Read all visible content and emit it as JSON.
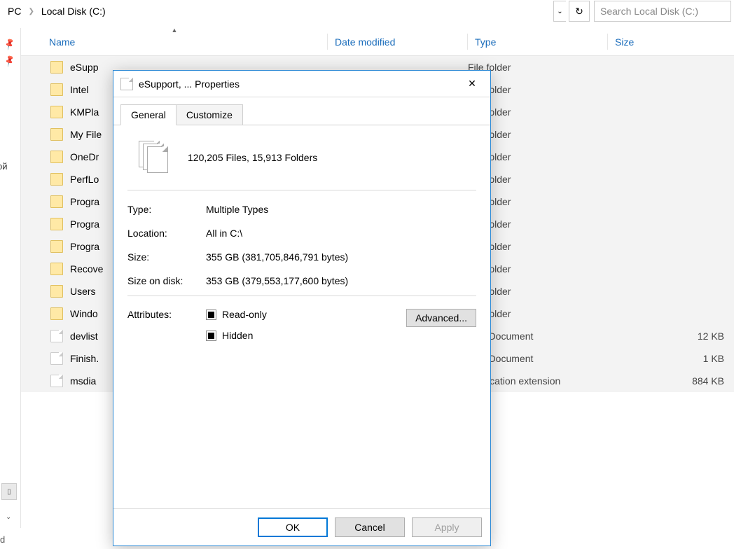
{
  "breadcrumb": {
    "seg1": "PC",
    "seg2": "Local Disk (C:)"
  },
  "search": {
    "placeholder": "Search Local Disk (C:)"
  },
  "sidebar": {
    "cutoff": "ой",
    "bottom": "d"
  },
  "columns": {
    "name": "Name",
    "date": "Date modified",
    "type": "Type",
    "size": "Size"
  },
  "rows": [
    {
      "name": "eSupp",
      "type": "File folder",
      "size": "",
      "icon": "folder"
    },
    {
      "name": "Intel",
      "type": "File folder",
      "size": "",
      "icon": "folder"
    },
    {
      "name": "KMPla",
      "type": "File folder",
      "size": "",
      "icon": "folder"
    },
    {
      "name": "My File",
      "type": "File folder",
      "size": "",
      "icon": "folder"
    },
    {
      "name": "OneDr",
      "type": "File folder",
      "size": "",
      "icon": "folder"
    },
    {
      "name": "PerfLo",
      "type": "File folder",
      "size": "",
      "icon": "folder"
    },
    {
      "name": "Progra",
      "type": "File folder",
      "size": "",
      "icon": "folder"
    },
    {
      "name": "Progra",
      "type": "File folder",
      "size": "",
      "icon": "folder"
    },
    {
      "name": "Progra",
      "type": "File folder",
      "size": "",
      "icon": "folder"
    },
    {
      "name": "Recove",
      "type": "File folder",
      "size": "",
      "icon": "folder"
    },
    {
      "name": "Users",
      "type": "File folder",
      "size": "",
      "icon": "folder"
    },
    {
      "name": "Windo",
      "type": "File folder",
      "size": "",
      "icon": "folder"
    },
    {
      "name": "devlist",
      "type": "Text Document",
      "size": "12 KB",
      "icon": "file"
    },
    {
      "name": "Finish.",
      "type": "Text Document",
      "size": "1 KB",
      "icon": "file"
    },
    {
      "name": "msdia",
      "type": "Application extension",
      "size": "884 KB",
      "icon": "file"
    }
  ],
  "dialog": {
    "title": "eSupport, ... Properties",
    "tabs": {
      "general": "General",
      "customize": "Customize"
    },
    "summary": "120,205 Files, 15,913 Folders",
    "props": {
      "type_label": "Type:",
      "type_value": "Multiple Types",
      "location_label": "Location:",
      "location_value": "All in C:\\",
      "size_label": "Size:",
      "size_value": "355 GB (381,705,846,791 bytes)",
      "sizeondisk_label": "Size on disk:",
      "sizeondisk_value": "353 GB (379,553,177,600 bytes)",
      "attributes_label": "Attributes:",
      "readonly": "Read-only",
      "hidden": "Hidden",
      "advanced": "Advanced..."
    },
    "buttons": {
      "ok": "OK",
      "cancel": "Cancel",
      "apply": "Apply"
    }
  }
}
